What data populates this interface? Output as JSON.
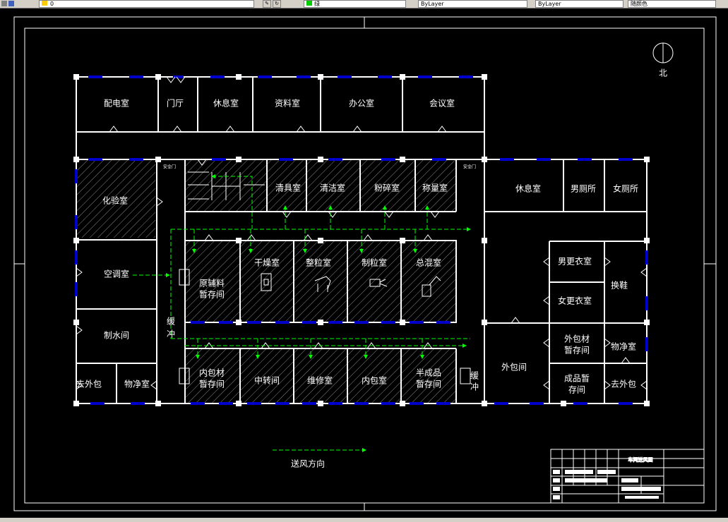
{
  "toolbar": {
    "layer_value": "0",
    "color_value": "绿",
    "linetype_value": "ByLayer",
    "lineweight_value": "ByLayer",
    "plot_value": "随颜色"
  },
  "north_label": "北",
  "rooms": {
    "peidian": "配电室",
    "menting": "门厅",
    "xiuxi1": "休息室",
    "ziliao": "资料室",
    "bangong": "办公室",
    "huiyi": "会议室",
    "huayan": "化验室",
    "qingju": "清具室",
    "qingjie": "清洁室",
    "fensui": "粉碎室",
    "chengliang": "称量室",
    "xiuxi2": "休息室",
    "nancesuo": "男厕所",
    "nvcesuo": "女厕所",
    "kongtiao": "空调室",
    "yuanfuliao": "原辅料",
    "zancunjian": "暂存间",
    "ganzao": "干燥室",
    "zhengli": "整粒室",
    "zhili": "制粒室",
    "zonghun": "总混室",
    "nangengyi": "男更衣室",
    "nvgengyi": "女更衣室",
    "huanxie": "换鞋",
    "zhishui": "制水间",
    "huan_left": "缓",
    "chong_left": "冲",
    "waibaocai": "外包材",
    "waibaocai2": "暂存间",
    "wujing1": "物净室",
    "neibaocai": "内包材",
    "neibaocai2": "暂存间",
    "zhongzhuan": "中转间",
    "weixiu": "维修室",
    "neibao": "内包室",
    "banchengpin": "半成品",
    "banchengpin2": "暂存间",
    "huan_right": "缓",
    "chong_right": "冲",
    "waibaojian": "外包间",
    "chengpin": "成品暂",
    "chengpin2": "存间",
    "quwaibao1": "去外包",
    "wujing2": "物净室",
    "quwaibao2": "去外包",
    "anquanmen_left": "安全门",
    "anquanmen_right": "安全门"
  },
  "legend_label": "送风方向",
  "title_block": {
    "drawing_title": "车间送风图"
  },
  "colors": {
    "background": "#000000",
    "wall": "#ffffff",
    "window": "#0000cc",
    "airflow": "#00ff00"
  }
}
